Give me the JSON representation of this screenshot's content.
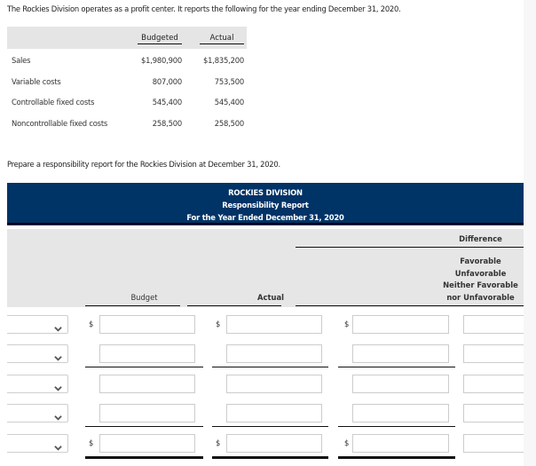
{
  "intro_text": "The Rockies Division operates as a profit center. It reports the following for the year ending December 31, 2020.",
  "given_table": {
    "headers": [
      "Budgeted",
      "Actual"
    ],
    "rows": [
      {
        "label": "Sales",
        "budgeted": "$1,980,900",
        "actual": "$1,835,200"
      },
      {
        "label": "Variable costs",
        "budgeted": "807,000",
        "actual": "753,500"
      },
      {
        "label": "Controllable fixed costs",
        "budgeted": "545,400",
        "actual": "545,400"
      },
      {
        "label": "Noncontrollable fixed costs",
        "budgeted": "258,500",
        "actual": "258,500"
      }
    ]
  },
  "prompt_text": "Prepare a responsibility report for the Rockies Division at December 31, 2020.",
  "report": {
    "banner": {
      "company": "ROCKIES DIVISION",
      "title": "Responsibility Report",
      "period": "For the Year Ended December 31, 2020"
    },
    "columns": {
      "budget": "Budget",
      "actual": "Actual",
      "difference": "Difference",
      "difference_options": [
        "Favorable",
        "Unfavorable",
        "Neither Favorable",
        "nor Unfavorable"
      ]
    },
    "currency_symbol": "$",
    "rows": [
      {
        "account": "",
        "budget": "",
        "actual": "",
        "difference": "",
        "status": "",
        "show_dollar": true
      },
      {
        "account": "",
        "budget": "",
        "actual": "",
        "difference": "",
        "status": "",
        "show_dollar": false
      },
      {
        "account": "",
        "budget": "",
        "actual": "",
        "difference": "",
        "status": "",
        "show_dollar": false
      },
      {
        "account": "",
        "budget": "",
        "actual": "",
        "difference": "",
        "status": "",
        "show_dollar": false
      },
      {
        "account": "",
        "budget": "",
        "actual": "",
        "difference": "",
        "status": "",
        "show_dollar": true
      }
    ],
    "icons": {
      "dropdown": "chevron-down-icon"
    }
  }
}
